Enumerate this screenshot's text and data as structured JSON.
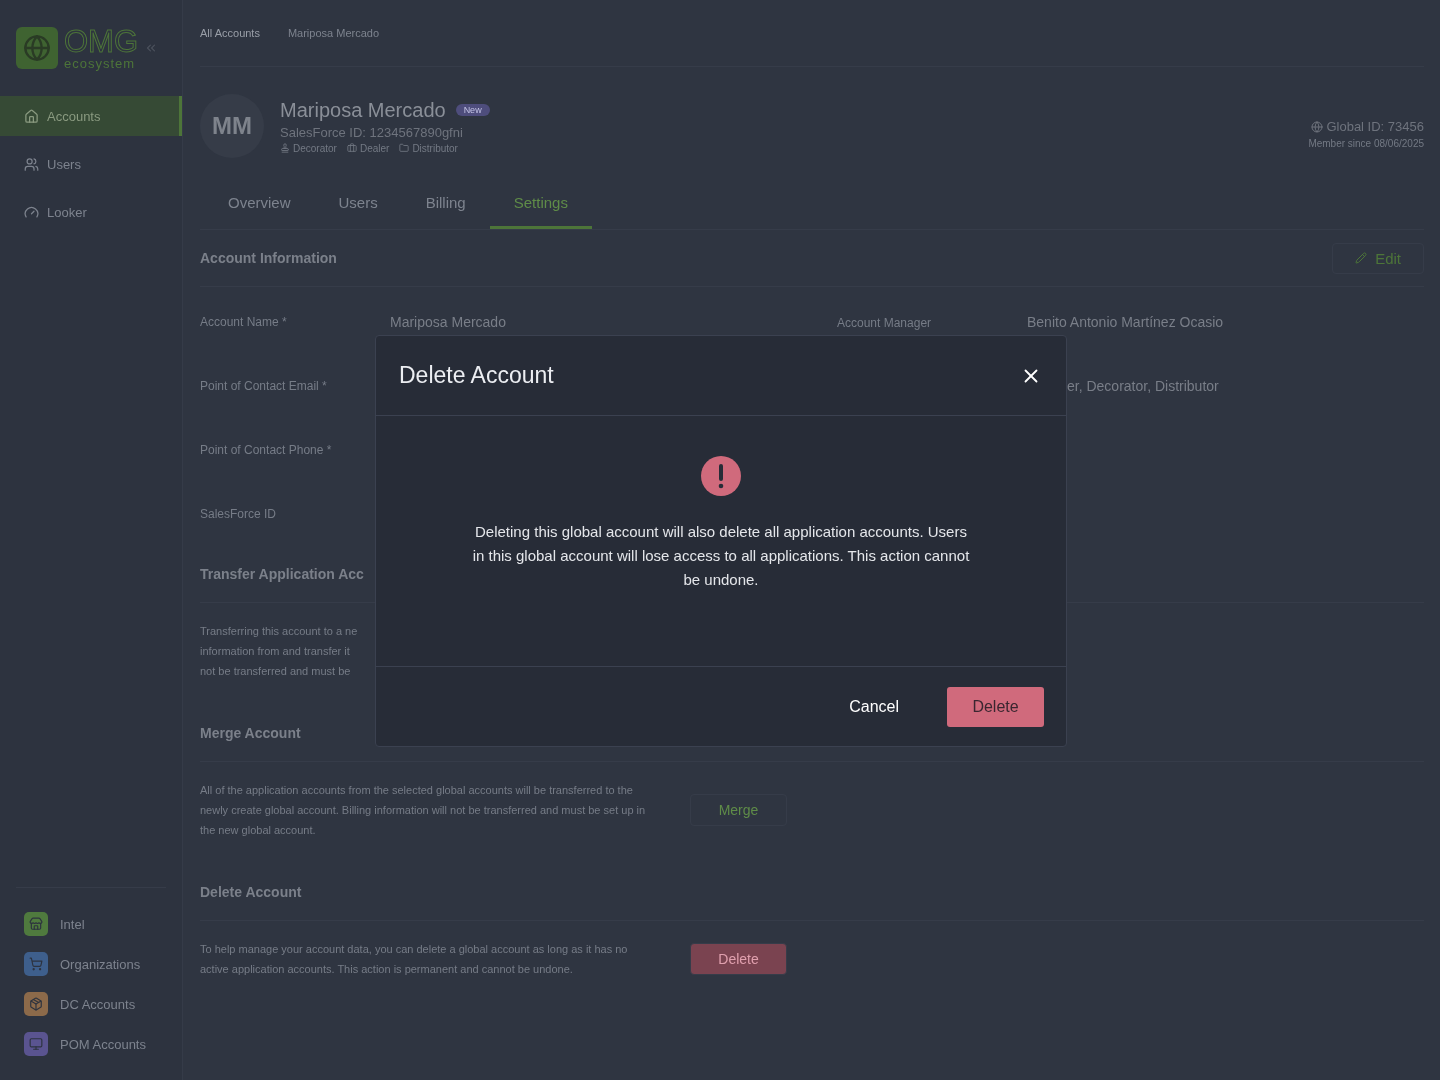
{
  "sidebar": {
    "logo": {
      "word": "OMG",
      "tagline": "ecosystem"
    },
    "nav": [
      {
        "label": "Accounts",
        "selected": true
      },
      {
        "label": "Users",
        "selected": false
      },
      {
        "label": "Looker",
        "selected": false
      }
    ],
    "apps": [
      {
        "label": "Intel",
        "color": "#4f7a3e"
      },
      {
        "label": "Organizations",
        "color": "#3e5f8c"
      },
      {
        "label": "DC Accounts",
        "color": "#8c6a4a"
      },
      {
        "label": "POM Accounts",
        "color": "#5a5490"
      }
    ]
  },
  "breadcrumb": [
    "All Accounts",
    "Mariposa Mercado"
  ],
  "account": {
    "initials": "MM",
    "name": "Mariposa Mercado",
    "badge": "New",
    "salesforce": "SalesForce ID: 1234567890gfni",
    "types": [
      "Decorator",
      "Dealer",
      "Distributor"
    ],
    "global_id": "Global ID: 73456",
    "member_since": "Member since 08/06/2025"
  },
  "tabs": [
    {
      "label": "Overview",
      "selected": false
    },
    {
      "label": "Users",
      "selected": false
    },
    {
      "label": "Billing",
      "selected": false
    },
    {
      "label": "Settings",
      "selected": true
    }
  ],
  "info": {
    "title": "Account Information",
    "edit": "Edit",
    "rows": [
      {
        "label": "Account Name *",
        "value": "Mariposa Mercado",
        "label2": "Account Manager",
        "value2": "Benito Antonio Martínez Ocasio"
      },
      {
        "label": "Point of Contact Email *",
        "value2": "er, Decorator, Distributor"
      },
      {
        "label": "Point of Contact Phone *"
      },
      {
        "label": "SalesForce ID"
      }
    ]
  },
  "transfer": {
    "title": "Transfer Application Acc",
    "lines": [
      "Transferring this account to a ne",
      "information from and transfer it",
      "not be transferred and must be"
    ]
  },
  "merge": {
    "title": "Merge Account",
    "text": "All of the application accounts from the selected global accounts will be transferred to the newly create global account. Billing information will not be transferred and must be set up in the new global account.",
    "button": "Merge"
  },
  "delete": {
    "title": "Delete Account",
    "text": "To help manage your account data, you can delete a global account as long as it has no active application accounts. This action is permanent and cannot be undone.",
    "button": "Delete"
  },
  "modal": {
    "title": "Delete Account",
    "message": "Deleting this global account will also delete all application accounts. Users in this global account will lose access to all applications. This action cannot be undone.",
    "cancel": "Cancel",
    "confirm": "Delete"
  }
}
